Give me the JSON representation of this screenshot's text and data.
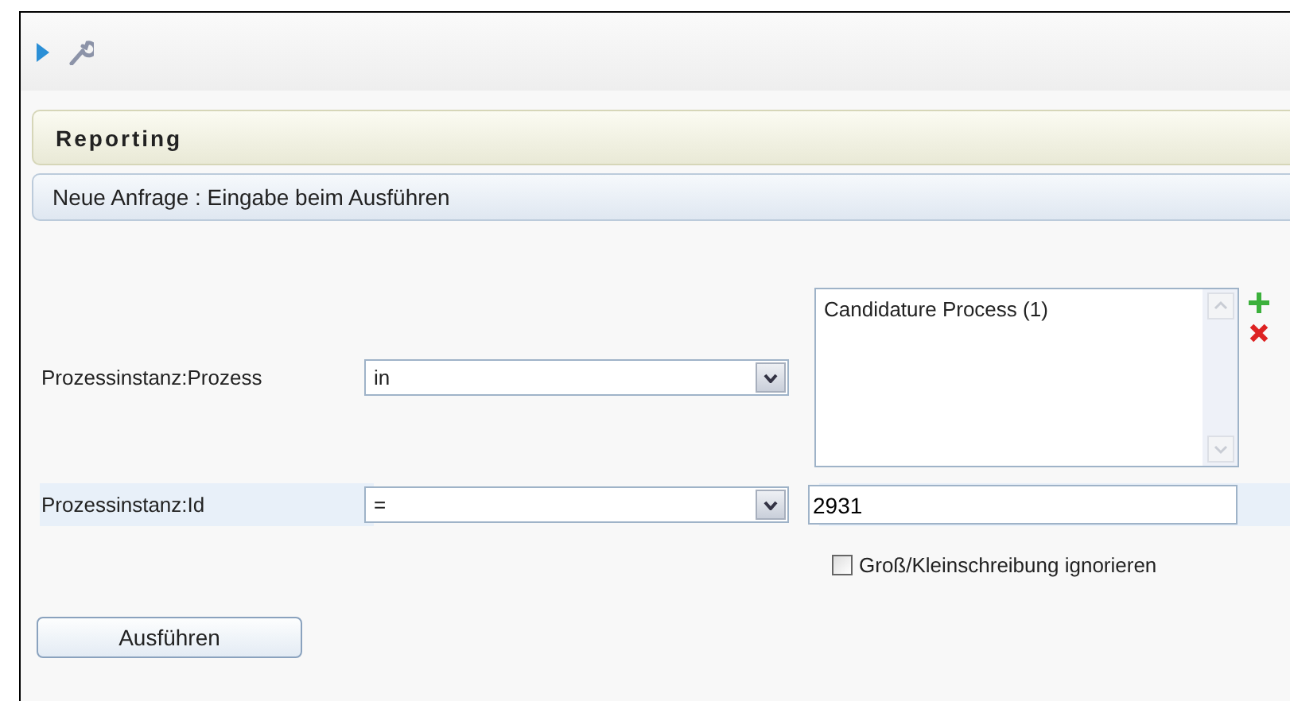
{
  "panel": {
    "title": "Reporting"
  },
  "query": {
    "title": "Neue Anfrage : Eingabe beim Ausführen"
  },
  "conditions": [
    {
      "kind": "list",
      "label": "Prozessinstanz:Prozess",
      "operator": "in",
      "highlighted": false,
      "items": [
        "Candidature Process (1)"
      ]
    },
    {
      "kind": "text",
      "label": "Prozessinstanz:Id",
      "operator": "=",
      "highlighted": true,
      "value": "2931",
      "option": {
        "label": "Groß/Kleinschreibung ignorieren",
        "checked": false
      }
    }
  ],
  "run_button": "Ausführen"
}
